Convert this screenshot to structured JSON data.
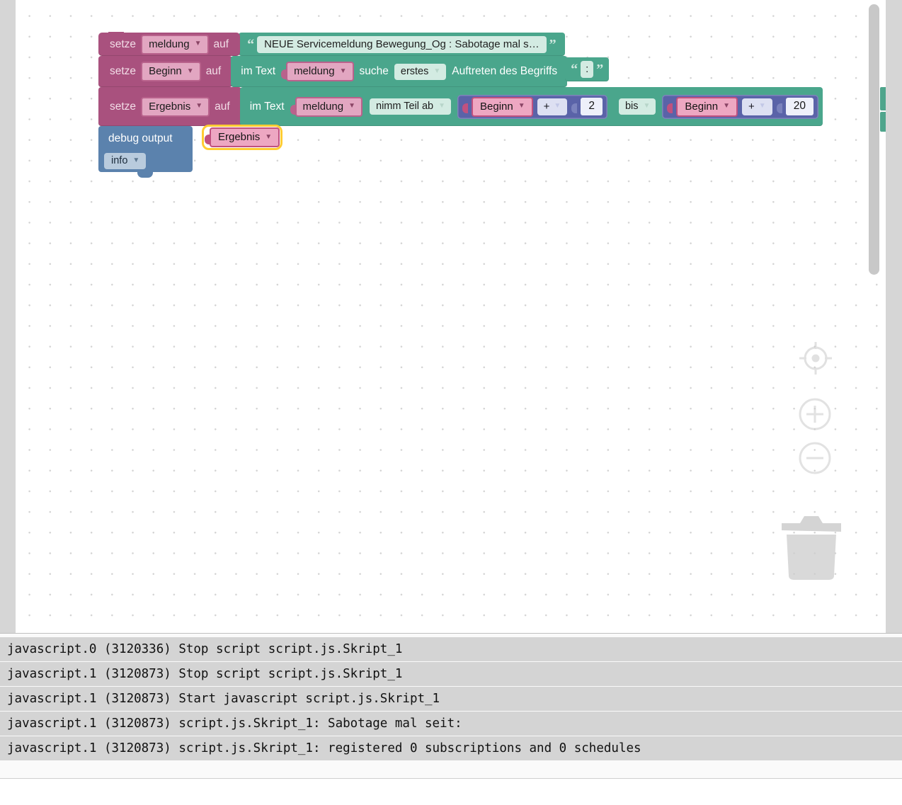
{
  "app": {
    "name": "Blockly script editor"
  },
  "canvas": {
    "blocks": {
      "row1": {
        "keyword": "setze",
        "variable": "meldung",
        "suffix": "auf",
        "string_value": "NEUE Servicemeldung Bewegung_Og : Sabotage mal s…",
        "open_quote": "“",
        "close_quote": "”"
      },
      "row2": {
        "keyword": "setze",
        "variable": "Beginn",
        "suffix": "auf",
        "in_text_label": "im Text",
        "text_var": "meldung",
        "search_label": "suche",
        "occurrence": "erstes",
        "occurrence_tail": "Auftreten des Begriffs",
        "needle": ":",
        "open_quote": "“",
        "close_quote": "”"
      },
      "row3": {
        "keyword": "setze",
        "variable": "Ergebnis",
        "suffix": "auf",
        "in_text_label": "im Text",
        "text_var": "meldung",
        "operation": "nimm Teil ab",
        "start_var": "Beginn",
        "start_op": "+",
        "start_num": "2",
        "range_label": "bis",
        "end_var": "Beginn",
        "end_op": "+",
        "end_num": "20"
      },
      "row4": {
        "label": "debug output",
        "value_var": "Ergebnis",
        "level": "info",
        "selected": true
      }
    },
    "controls": {
      "center": "target-center-icon",
      "zoom_in": "zoom-in-icon",
      "zoom_out": "zoom-out-icon",
      "trash": "trash-icon"
    }
  },
  "log": {
    "lines": [
      "javascript.0 (3120336) Stop script script.js.Skript_1",
      "javascript.1 (3120873) Stop script script.js.Skript_1",
      "javascript.1 (3120873) Start javascript script.js.Skript_1",
      "javascript.1 (3120873) script.js.Skript_1: Sabotage mal seit:",
      "javascript.1 (3120873) script.js.Skript_1: registered 0 subscriptions and 0 schedules"
    ]
  },
  "colors": {
    "variable_block": "#a9517e",
    "text_block": "#4aa68c",
    "math_block": "#5a63a8",
    "debug_block": "#5b82ad",
    "selection": "#ffcc33"
  }
}
